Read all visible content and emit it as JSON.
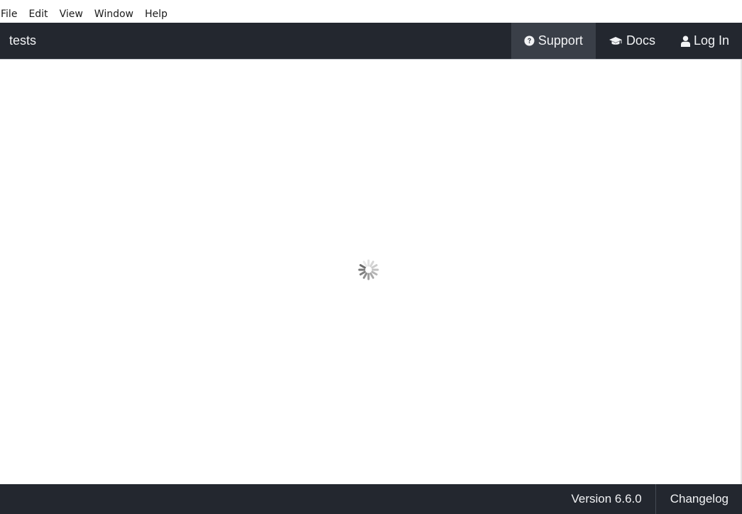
{
  "menubar": {
    "items": [
      "File",
      "Edit",
      "View",
      "Window",
      "Help"
    ]
  },
  "navbar": {
    "project_name": "tests",
    "support_label": "Support",
    "docs_label": "Docs",
    "login_label": "Log In"
  },
  "main": {
    "loading_indicator": "spinner-icon"
  },
  "footer": {
    "version_label": "Version 6.6.0",
    "changelog_label": "Changelog"
  },
  "colors": {
    "navbar_bg": "#23272f",
    "active_nav_bg": "#3a3f48",
    "text_light": "#f2f3f5"
  }
}
